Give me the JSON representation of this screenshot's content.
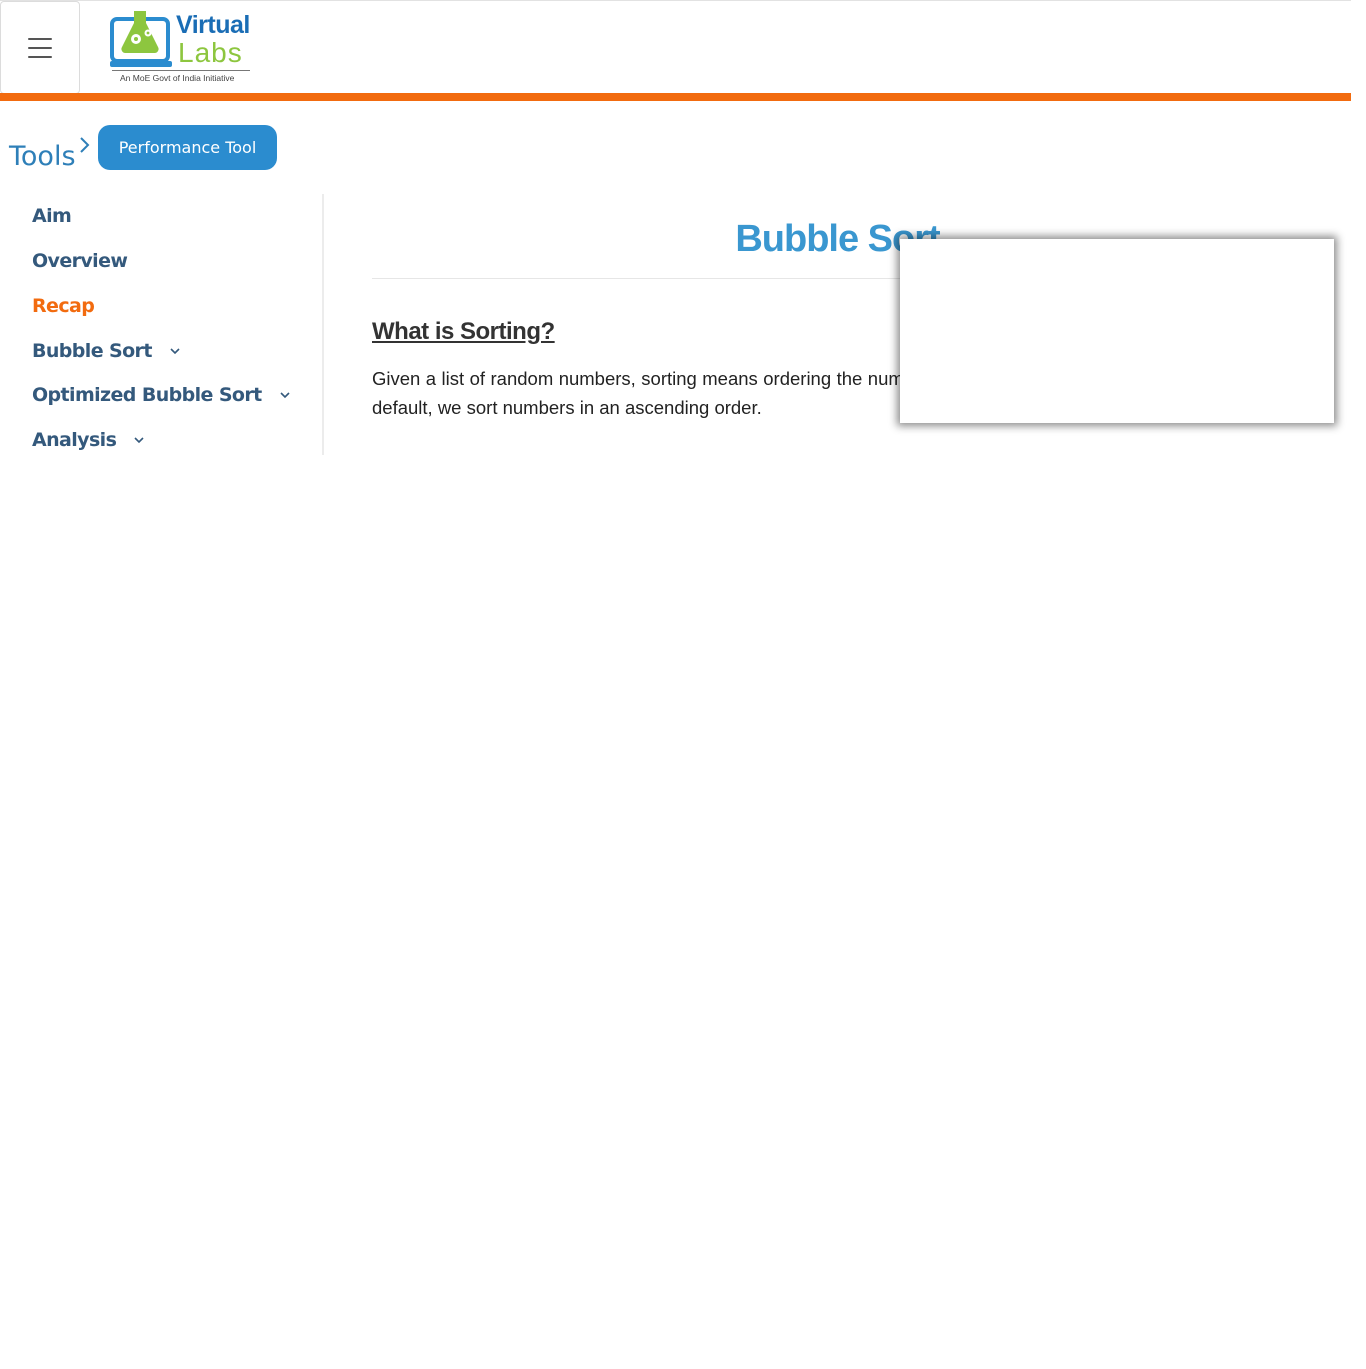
{
  "header": {
    "menu_icon": "hamburger-menu-icon",
    "logo": {
      "word1": "Virtual",
      "word2": "Labs",
      "tagline": "An MoE Govt of India Initiative"
    },
    "accent_color": "#f26b0f"
  },
  "breadcrumb": {
    "root": "Tools",
    "separator_icon": "chevron-right-icon",
    "current": "Performance Tool"
  },
  "sidebar": {
    "items": [
      {
        "label": "Aim",
        "expandable": false,
        "active": false
      },
      {
        "label": "Overview",
        "expandable": false,
        "active": false
      },
      {
        "label": "Recap",
        "expandable": false,
        "active": true
      },
      {
        "label": "Bubble Sort",
        "expandable": true,
        "active": false
      },
      {
        "label": "Optimized Bubble Sort",
        "expandable": true,
        "active": false
      },
      {
        "label": "Analysis",
        "expandable": true,
        "active": false
      }
    ]
  },
  "main": {
    "title": "Bubble Sort",
    "section_heading": "What is Sorting?",
    "paragraph": "Given a list of random numbers, sorting means ordering the numbers in either ascending or descending order. By default, we sort numbers in an ascending order."
  },
  "colors": {
    "brand_blue": "#2b8ccf",
    "title_blue": "#3a97d0",
    "nav_text": "#34597c",
    "active_orange": "#f26b0f"
  }
}
